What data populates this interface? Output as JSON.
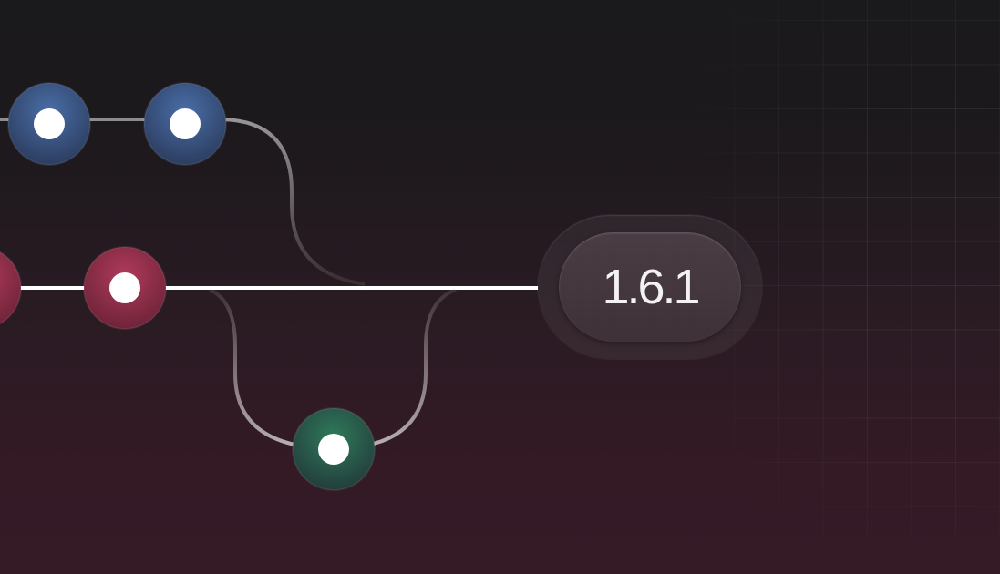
{
  "version_badge": {
    "label": "1.6.1"
  },
  "colors": {
    "blue_commit": "#3c5a8a",
    "red_commit": "#a03250",
    "green_commit": "#2a6b50",
    "main_line": "#ffffff",
    "branch_line": "#8f8a8e"
  },
  "icons": [
    "commit-node-icon"
  ]
}
